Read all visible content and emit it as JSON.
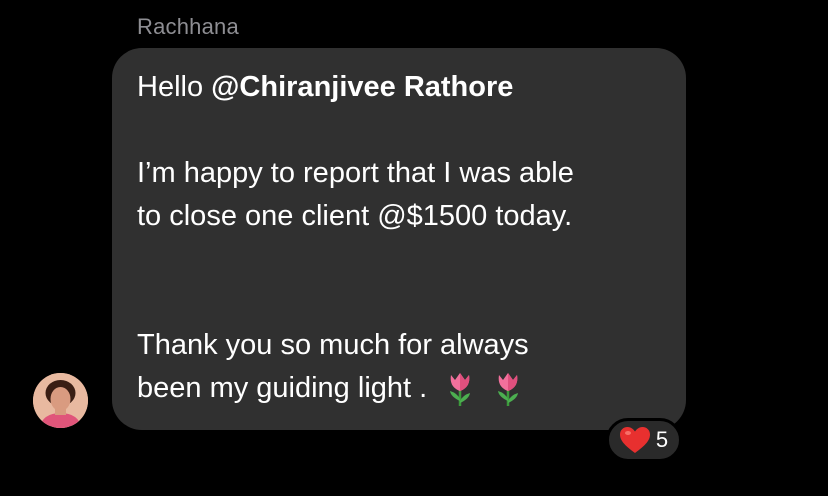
{
  "message": {
    "sender": "Rachhana",
    "greeting": "Hello ",
    "mention": "@Chiranjivee Rathore",
    "para1_line1": "I’m happy to report that I was able",
    "para1_line2": "to close one client @$1500 today.",
    "para2_line1": "Thank you so much for always",
    "para2_line2": "been my guiding light .",
    "emojis": [
      "tulip-icon",
      "tulip-icon"
    ]
  },
  "reaction": {
    "icon": "heart-icon",
    "count": "5"
  },
  "colors": {
    "background": "#000000",
    "bubble": "#303030",
    "sender_name": "#8e8e93",
    "heart": "#e8302f",
    "tulip": "#f2709c"
  }
}
